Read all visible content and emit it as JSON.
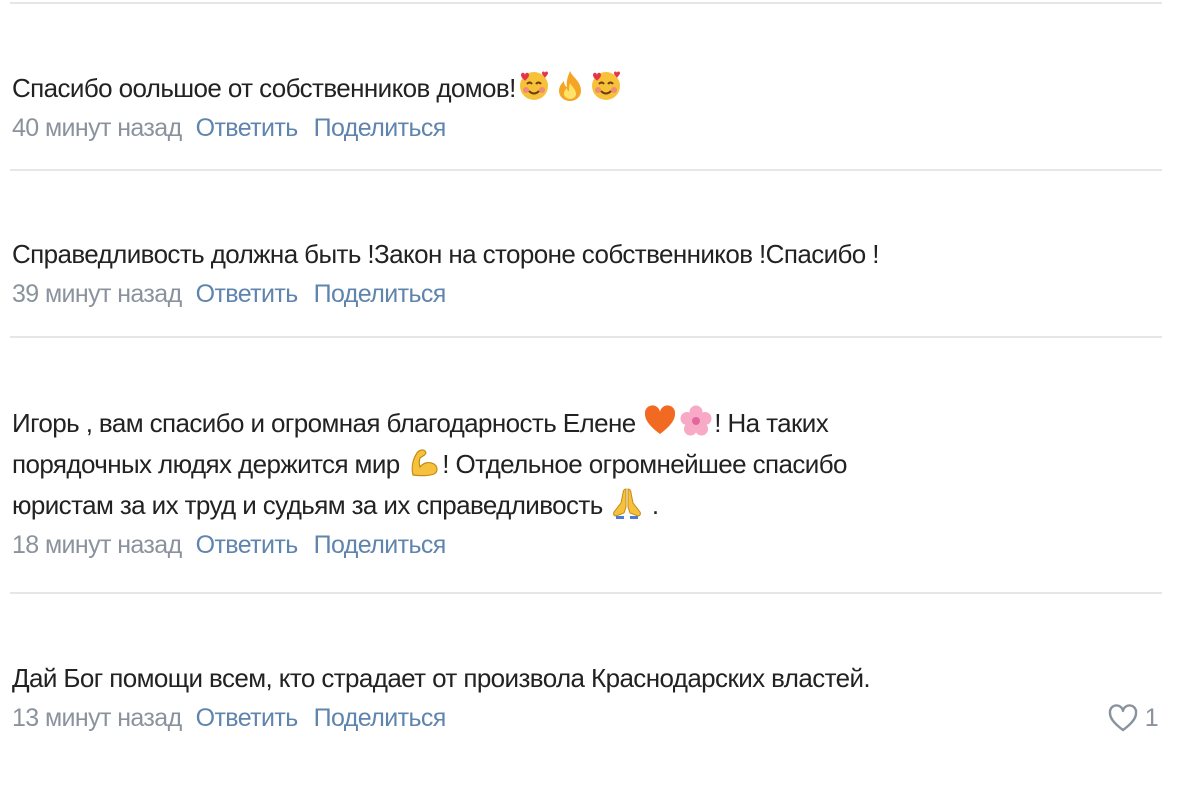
{
  "comments": [
    {
      "text_parts": [
        "Спасибо оольшое от собственников домов!"
      ],
      "emojis": [
        "smiling-face-with-hearts-icon",
        "fire-icon",
        "smiling-face-with-hearts-icon"
      ],
      "time": "40 минут назад",
      "reply": "Ответить",
      "share": "Поделиться"
    },
    {
      "text_parts": [
        "Справедливость должна быть !Закон на стороне собственников !Спасибо !"
      ],
      "time": "39 минут назад",
      "reply": "Ответить",
      "share": "Поделиться"
    },
    {
      "text_parts": [
        "Игорь , вам спасибо и огромная благодарность Елене ",
        "! На таких",
        "порядочных людях держится мир ",
        "! Отдельное огромнейшее спасибо",
        "юристам за их труд и судьям за их справедливость ",
        " ."
      ],
      "emojis": [
        "orange-heart-icon",
        "cherry-blossom-icon",
        "flexed-biceps-icon",
        "folded-hands-icon"
      ],
      "time": "18 минут назад",
      "reply": "Ответить",
      "share": "Поделиться"
    },
    {
      "text_parts": [
        "Дай Бог помощи всем, кто страдает от произвола Краснодарских властей."
      ],
      "time": "13 минут назад",
      "reply": "Ответить",
      "share": "Поделиться",
      "likes": "1"
    }
  ],
  "colors": {
    "text": "#222222",
    "time": "#8a939d",
    "link": "#5f84ad",
    "divider": "#e4e6ea"
  }
}
